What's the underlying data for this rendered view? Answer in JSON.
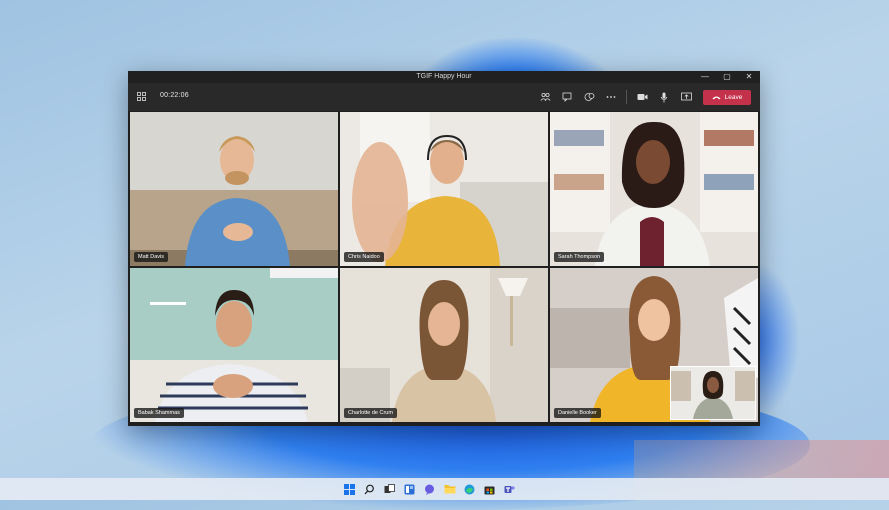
{
  "window": {
    "title": "TGIF Happy Hour",
    "controls": [
      "—",
      "▢",
      "✕"
    ]
  },
  "toolbar": {
    "timer": "00:22:06",
    "leave_label": "Leave",
    "accent": "#c4314b"
  },
  "participants": [
    {
      "name": "Matt Davis",
      "shirt": "#5b8fc7",
      "wall": "#d9d7d3"
    },
    {
      "name": "Chris Naidoo",
      "shirt": "#e8b43a",
      "wall": "#ece9e4"
    },
    {
      "name": "Sarah Thompson",
      "shirt": "#f2f2ef",
      "wall": "#e4ddd4"
    },
    {
      "name": "Babak Shammas",
      "shirt": "#e9e9ee",
      "wall": "#a9cfc6"
    },
    {
      "name": "Charlotte de Crum",
      "shirt": "#d9c3a5",
      "wall": "#e6e1d9"
    },
    {
      "name": "Danielle Booker",
      "shirt": "#f1b52a",
      "wall": "#d9d2cc"
    }
  ],
  "taskbar_icons": [
    "windows-icon",
    "search-icon",
    "task-view-icon",
    "widgets-icon",
    "chat-icon",
    "file-explorer-icon",
    "edge-icon",
    "store-icon",
    "teams-icon"
  ]
}
